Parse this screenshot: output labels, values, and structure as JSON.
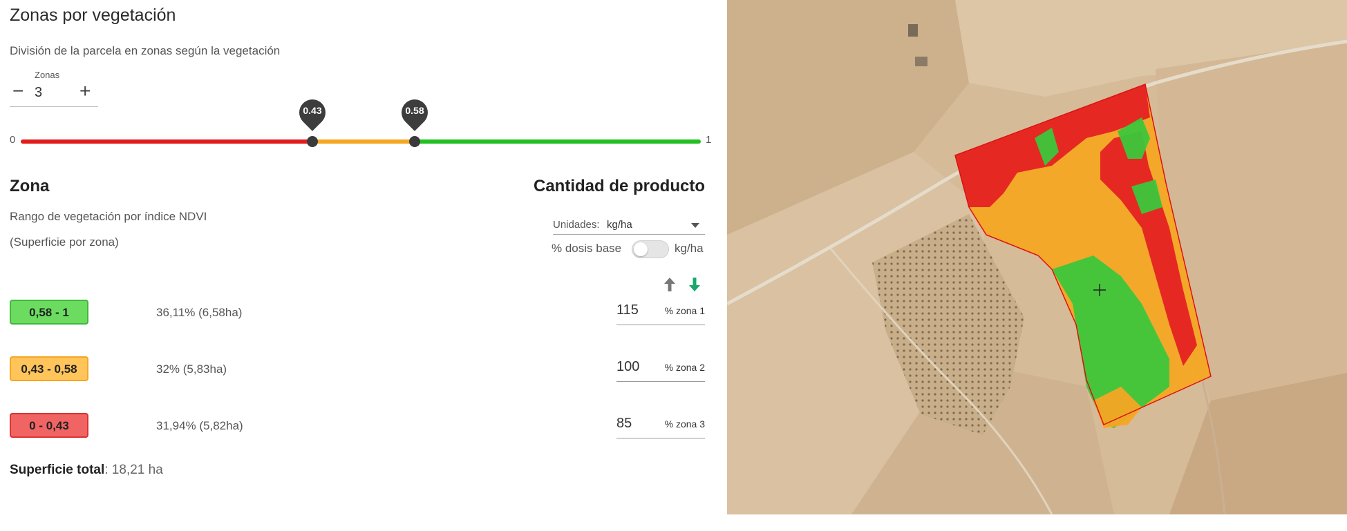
{
  "header": {
    "title": "Zonas por vegetación",
    "subtitle": "División de la parcela en zonas según la vegetación"
  },
  "zonas_stepper": {
    "label": "Zonas",
    "value": "3",
    "minus": "−",
    "plus": "+"
  },
  "slider": {
    "min_label": "0",
    "max_label": "1",
    "thresholds": [
      "0.43",
      "0.58"
    ],
    "threshold_values": [
      0.43,
      0.58
    ]
  },
  "zone_section": {
    "heading": "Zona",
    "range_label": "Rango de vegetación por índice NDVI",
    "area_label": "(Superficie por zona)"
  },
  "product_section": {
    "heading": "Cantidad de producto",
    "units_label": "Unidades:",
    "units_value": "kg/ha",
    "dosis_label": "% dosis base",
    "dosis_alt_label": "kg/ha"
  },
  "zones": [
    {
      "range": "0,58 - 1",
      "area": "36,11%  (6,58ha)",
      "quantity": "115",
      "unit": "% zona 1",
      "color": "#6bdc5f",
      "border": "#3fb83a"
    },
    {
      "range": "0,43 - 0,58",
      "area": "32%  (5,83ha)",
      "quantity": "100",
      "unit": "% zona 2",
      "color": "#ffc45a",
      "border": "#f5a623"
    },
    {
      "range": "0 - 0,43",
      "area": "31,94%  (5,82ha)",
      "quantity": "85",
      "unit": "% zona 3",
      "color": "#f06464",
      "border": "#d9342f"
    }
  ],
  "total": {
    "label": "Superficie total",
    "value": ": 18,21 ha"
  },
  "colors": {
    "red": "#e21b1b",
    "orange": "#f5a623",
    "green": "#22c022",
    "sort_up": "#777777",
    "sort_down": "#1aa86a"
  },
  "icons": {
    "sort_up": "arrow-up-icon",
    "sort_down": "arrow-down-icon",
    "dropdown": "caret-down-icon",
    "crosshair": "crosshair-icon"
  }
}
